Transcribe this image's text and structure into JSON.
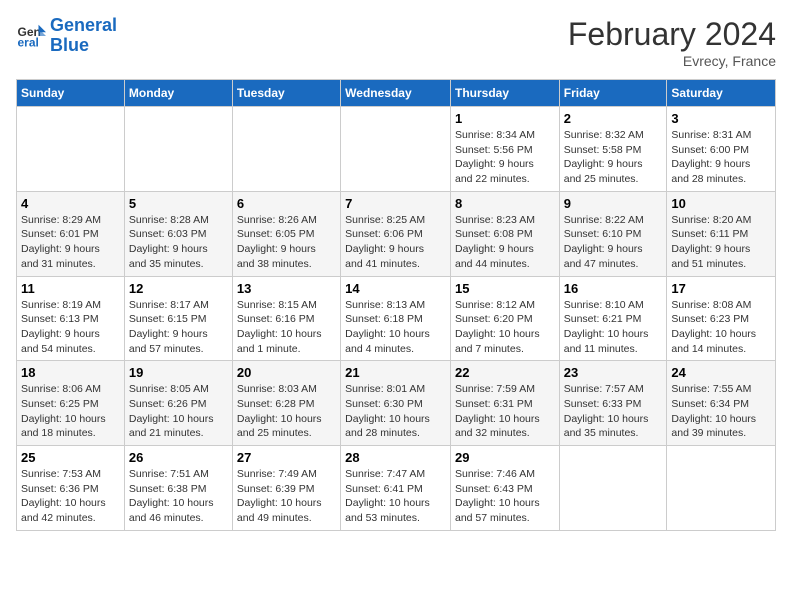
{
  "header": {
    "logo_line1": "General",
    "logo_line2": "Blue",
    "main_title": "February 2024",
    "subtitle": "Evrecy, France"
  },
  "columns": [
    "Sunday",
    "Monday",
    "Tuesday",
    "Wednesday",
    "Thursday",
    "Friday",
    "Saturday"
  ],
  "weeks": [
    [
      {
        "day": "",
        "info": ""
      },
      {
        "day": "",
        "info": ""
      },
      {
        "day": "",
        "info": ""
      },
      {
        "day": "",
        "info": ""
      },
      {
        "day": "1",
        "info": "Sunrise: 8:34 AM\nSunset: 5:56 PM\nDaylight: 9 hours\nand 22 minutes."
      },
      {
        "day": "2",
        "info": "Sunrise: 8:32 AM\nSunset: 5:58 PM\nDaylight: 9 hours\nand 25 minutes."
      },
      {
        "day": "3",
        "info": "Sunrise: 8:31 AM\nSunset: 6:00 PM\nDaylight: 9 hours\nand 28 minutes."
      }
    ],
    [
      {
        "day": "4",
        "info": "Sunrise: 8:29 AM\nSunset: 6:01 PM\nDaylight: 9 hours\nand 31 minutes."
      },
      {
        "day": "5",
        "info": "Sunrise: 8:28 AM\nSunset: 6:03 PM\nDaylight: 9 hours\nand 35 minutes."
      },
      {
        "day": "6",
        "info": "Sunrise: 8:26 AM\nSunset: 6:05 PM\nDaylight: 9 hours\nand 38 minutes."
      },
      {
        "day": "7",
        "info": "Sunrise: 8:25 AM\nSunset: 6:06 PM\nDaylight: 9 hours\nand 41 minutes."
      },
      {
        "day": "8",
        "info": "Sunrise: 8:23 AM\nSunset: 6:08 PM\nDaylight: 9 hours\nand 44 minutes."
      },
      {
        "day": "9",
        "info": "Sunrise: 8:22 AM\nSunset: 6:10 PM\nDaylight: 9 hours\nand 47 minutes."
      },
      {
        "day": "10",
        "info": "Sunrise: 8:20 AM\nSunset: 6:11 PM\nDaylight: 9 hours\nand 51 minutes."
      }
    ],
    [
      {
        "day": "11",
        "info": "Sunrise: 8:19 AM\nSunset: 6:13 PM\nDaylight: 9 hours\nand 54 minutes."
      },
      {
        "day": "12",
        "info": "Sunrise: 8:17 AM\nSunset: 6:15 PM\nDaylight: 9 hours\nand 57 minutes."
      },
      {
        "day": "13",
        "info": "Sunrise: 8:15 AM\nSunset: 6:16 PM\nDaylight: 10 hours\nand 1 minute."
      },
      {
        "day": "14",
        "info": "Sunrise: 8:13 AM\nSunset: 6:18 PM\nDaylight: 10 hours\nand 4 minutes."
      },
      {
        "day": "15",
        "info": "Sunrise: 8:12 AM\nSunset: 6:20 PM\nDaylight: 10 hours\nand 7 minutes."
      },
      {
        "day": "16",
        "info": "Sunrise: 8:10 AM\nSunset: 6:21 PM\nDaylight: 10 hours\nand 11 minutes."
      },
      {
        "day": "17",
        "info": "Sunrise: 8:08 AM\nSunset: 6:23 PM\nDaylight: 10 hours\nand 14 minutes."
      }
    ],
    [
      {
        "day": "18",
        "info": "Sunrise: 8:06 AM\nSunset: 6:25 PM\nDaylight: 10 hours\nand 18 minutes."
      },
      {
        "day": "19",
        "info": "Sunrise: 8:05 AM\nSunset: 6:26 PM\nDaylight: 10 hours\nand 21 minutes."
      },
      {
        "day": "20",
        "info": "Sunrise: 8:03 AM\nSunset: 6:28 PM\nDaylight: 10 hours\nand 25 minutes."
      },
      {
        "day": "21",
        "info": "Sunrise: 8:01 AM\nSunset: 6:30 PM\nDaylight: 10 hours\nand 28 minutes."
      },
      {
        "day": "22",
        "info": "Sunrise: 7:59 AM\nSunset: 6:31 PM\nDaylight: 10 hours\nand 32 minutes."
      },
      {
        "day": "23",
        "info": "Sunrise: 7:57 AM\nSunset: 6:33 PM\nDaylight: 10 hours\nand 35 minutes."
      },
      {
        "day": "24",
        "info": "Sunrise: 7:55 AM\nSunset: 6:34 PM\nDaylight: 10 hours\nand 39 minutes."
      }
    ],
    [
      {
        "day": "25",
        "info": "Sunrise: 7:53 AM\nSunset: 6:36 PM\nDaylight: 10 hours\nand 42 minutes."
      },
      {
        "day": "26",
        "info": "Sunrise: 7:51 AM\nSunset: 6:38 PM\nDaylight: 10 hours\nand 46 minutes."
      },
      {
        "day": "27",
        "info": "Sunrise: 7:49 AM\nSunset: 6:39 PM\nDaylight: 10 hours\nand 49 minutes."
      },
      {
        "day": "28",
        "info": "Sunrise: 7:47 AM\nSunset: 6:41 PM\nDaylight: 10 hours\nand 53 minutes."
      },
      {
        "day": "29",
        "info": "Sunrise: 7:46 AM\nSunset: 6:43 PM\nDaylight: 10 hours\nand 57 minutes."
      },
      {
        "day": "",
        "info": ""
      },
      {
        "day": "",
        "info": ""
      }
    ]
  ]
}
